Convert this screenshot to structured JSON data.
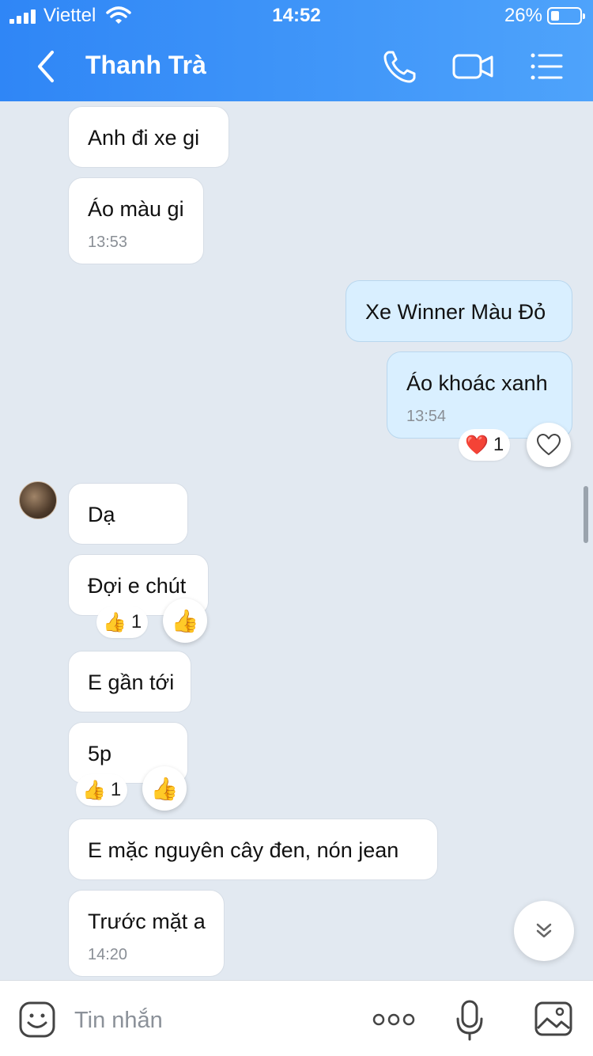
{
  "status_bar": {
    "carrier": "Viettel",
    "time": "14:52",
    "battery": "26%"
  },
  "header": {
    "title": "Thanh Trà",
    "icons": [
      "back-icon",
      "phone-icon",
      "video-call-icon",
      "list-menu-icon"
    ]
  },
  "messages": [
    {
      "text": "Anh đi xe gi",
      "time": ""
    },
    {
      "text": "Áo màu gi",
      "time": "13:53"
    },
    {
      "text": "Xe Winner Màu Đỏ",
      "time": ""
    },
    {
      "text": "Áo khoác xanh",
      "time": "13:54",
      "reaction": {
        "emoji": "❤️",
        "count": "1"
      }
    },
    {
      "text": "Dạ",
      "time": ""
    },
    {
      "text": "Đợi e chút",
      "time": "",
      "reaction": {
        "emoji": "👍",
        "count": "1"
      }
    },
    {
      "text": "E gần tới",
      "time": ""
    },
    {
      "text": "5p",
      "time": "",
      "reaction": {
        "emoji": "👍",
        "count": "1"
      }
    },
    {
      "text": "E mặc nguyên cây đen, nón jean",
      "time": ""
    },
    {
      "text": "Trước mặt a",
      "time": "14:20"
    }
  ],
  "composer": {
    "placeholder": "Tin nhắn",
    "icons": [
      "emoji-icon",
      "more-options-icon",
      "microphone-icon",
      "image-icon"
    ]
  },
  "colors": {
    "header": "#3b93f8",
    "background": "#e2e9f1",
    "mine_bubble": "#d9efff"
  }
}
